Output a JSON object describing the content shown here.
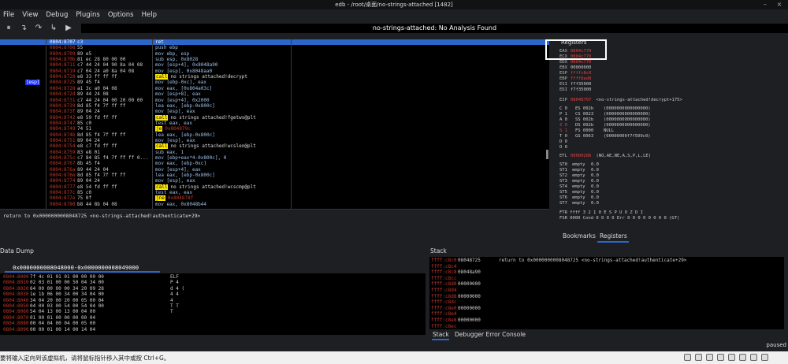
{
  "window": {
    "title": "edb - /root/桌面/no-strings-attached [1482]",
    "minimize": "–",
    "close": "×"
  },
  "menu": [
    "File",
    "View",
    "Debug",
    "Plugins",
    "Options",
    "Help"
  ],
  "toolbar": {
    "status": "no-strings-attached: No Analysis Found"
  },
  "disassembly": {
    "esp_tag": "[esp]",
    "rows": [
      {
        "addr": "0804:8707",
        "bytes": "c3",
        "ins": "ret"
      },
      {
        "addr": "0804:8708",
        "bytes": "55",
        "ins": "push ebp"
      },
      {
        "addr": "0804:8709",
        "bytes": "89 e5",
        "ins": "mov ebp, esp"
      },
      {
        "addr": "0804:870b",
        "bytes": "81 ec 28 80 00 00",
        "ins": "sub esp, 0x8028"
      },
      {
        "addr": "0804:8711",
        "bytes": "c7 44 24 04 90 8a 04 08",
        "ins": "mov [esp+4], 0x8048a90"
      },
      {
        "addr": "0804:8719",
        "bytes": "c7 04 24 a0 8a 04 08",
        "ins": "mov [esp], 0x8048aa0"
      },
      {
        "addr": "0804:8720",
        "bytes": "e8 33 ff ff ff",
        "ins": "call",
        "call": "no strings attached!decrypt"
      },
      {
        "addr": "0804:8725",
        "bytes": "89 45 f4",
        "ins": "mov [ebp-0xc], eax"
      },
      {
        "addr": "0804:8728",
        "bytes": "a1 3c a0 04 08",
        "ins": "mov eax, [0x804a03c]"
      },
      {
        "addr": "0804:872d",
        "bytes": "89 44 24 08",
        "ins": "mov [esp+8], eax"
      },
      {
        "addr": "0804:8731",
        "bytes": "c7 44 24 04 00 20 00 00",
        "ins": "mov [esp+4], 0x2000"
      },
      {
        "addr": "0804:8739",
        "bytes": "8d 85 f4 7f ff ff",
        "ins": "lea eax, [ebp-0x800c]"
      },
      {
        "addr": "0804:873f",
        "bytes": "89 04 24",
        "ins": "mov [esp], eax"
      },
      {
        "addr": "0804:8742",
        "bytes": "e8 59 fd ff ff",
        "ins": "call",
        "call": "no strings attached!fgetws@plt"
      },
      {
        "addr": "0804:8747",
        "bytes": "85 c0",
        "ins": "test eax, eax"
      },
      {
        "addr": "0804:8749",
        "bytes": "74 51",
        "ins": "je",
        "je": "0x804879c"
      },
      {
        "addr": "0804:874b",
        "bytes": "8d 85 f4 7f ff ff",
        "ins": "lea eax, [ebp-0x800c]"
      },
      {
        "addr": "0804:8751",
        "bytes": "89 04 24",
        "ins": "mov [esp], eax"
      },
      {
        "addr": "0804:8754",
        "bytes": "e8 c7 fd ff ff",
        "ins": "call",
        "call": "no strings attached!wcslen@plt"
      },
      {
        "addr": "0804:8759",
        "bytes": "83 e8 01",
        "ins": "sub eax, 1"
      },
      {
        "addr": "0804:875c",
        "bytes": "c7 84 85 f4 7f ff ff 0...",
        "ins": "mov [ebp+eax*4-0x800c], 0"
      },
      {
        "addr": "0804:8767",
        "bytes": "8b 45 f4",
        "ins": "mov eax, [ebp-0xc]"
      },
      {
        "addr": "0804:876a",
        "bytes": "89 44 24 04",
        "ins": "mov [esp+4], eax"
      },
      {
        "addr": "0804:876e",
        "bytes": "8d 85 f4 7f ff ff",
        "ins": "lea eax, [ebp-0x800c]"
      },
      {
        "addr": "0804:8774",
        "bytes": "89 04 24",
        "ins": "mov [esp], eax"
      },
      {
        "addr": "0804:8777",
        "bytes": "e8 54 fd ff ff",
        "ins": "call",
        "call": "no strings attached!wcscmp@plt"
      },
      {
        "addr": "0804:877c",
        "bytes": "85 c0",
        "ins": "test eax, eax"
      },
      {
        "addr": "0804:877e",
        "bytes": "75 0f",
        "ins": "jne",
        "je": "0x804878f"
      },
      {
        "addr": "0804:8780",
        "bytes": "b8 44 8b 04 08",
        "ins": "mov eax, 0x8048b44"
      }
    ],
    "return_text": "return to 0x0000000008048725 <no-strings-attached!authenticate+29>"
  },
  "registers": {
    "title": "Registers",
    "gp": [
      {
        "name": "EAX",
        "value": "0804c770",
        "red": true
      },
      {
        "name": "ECX",
        "value": "0804c770",
        "red": true
      },
      {
        "name": "EDX",
        "value": "0804c770",
        "red": true
      },
      {
        "name": "EBX",
        "value": "00000000",
        "red": false
      },
      {
        "name": "ESP",
        "value": "ffffc8c0",
        "red": true
      },
      {
        "name": "EBP",
        "value": "ffff8ad8",
        "red": true
      },
      {
        "name": "ESI",
        "value": "f7f35000",
        "red": false
      },
      {
        "name": "EDI",
        "value": "f7f35000",
        "red": false
      }
    ],
    "eip": {
      "name": "EIP",
      "value": "08048707",
      "desc": "<no-strings-attached!decrypt+175>"
    },
    "flags": [
      {
        "f": "C 0",
        "seg": "ES 002b",
        "seg_desc": "(0000000000000000)"
      },
      {
        "f": "P 1",
        "seg": "CS 0023",
        "seg_desc": "(0000000000000000)"
      },
      {
        "f": "A 0",
        "seg": "SS 002b",
        "seg_desc": "(0000000000000000)"
      },
      {
        "f": "Z 0",
        "seg": "DS 002b",
        "seg_desc": "(0000000000000000)"
      },
      {
        "f": "S 1",
        "seg": "FS 0000",
        "seg_desc": "NULL"
      },
      {
        "f": "T 0",
        "seg": "GS 0063",
        "seg_desc": "(00000000f7f509c0)"
      },
      {
        "f": "D 0",
        "seg": "",
        "seg_desc": ""
      },
      {
        "f": "O 0",
        "seg": "",
        "seg_desc": ""
      }
    ],
    "efl": {
      "name": "EFL",
      "value": "00000286",
      "desc": "(NO,AE,NE,A,S,P,L,LE)"
    },
    "fpu": [
      {
        "name": "ST0",
        "status": "empty",
        "val": "0.0"
      },
      {
        "name": "ST1",
        "status": "empty",
        "val": "0.0"
      },
      {
        "name": "ST2",
        "status": "empty",
        "val": "0.0"
      },
      {
        "name": "ST3",
        "status": "empty",
        "val": "0.0"
      },
      {
        "name": "ST4",
        "status": "empty",
        "val": "0.0"
      },
      {
        "name": "ST5",
        "status": "empty",
        "val": "0.0"
      },
      {
        "name": "ST6",
        "status": "empty",
        "val": "0.0"
      },
      {
        "name": "ST7",
        "status": "empty",
        "val": "0.0"
      }
    ],
    "ftr": "FTR  ffff        3 2 1 0      E S P U O Z D I",
    "fsr": "FSR  0000   Cond  0 0 0 0   Err  0 0 0 0 0 0 0 0  (GT)"
  },
  "reg_tabs": {
    "bookmarks": "Bookmarks",
    "registers": "Registers"
  },
  "dump": {
    "title": "Data Dump",
    "range": "0x0000000008048000-0x0000000008049000",
    "rows": [
      {
        "addr": "0804:8000",
        "hex": "7f  4c  01  01  01  00  00  00  00",
        "ascii": "ELF"
      },
      {
        "addr": "0804:8010",
        "hex": "02  03  01  00  00  50  04  34  00",
        "ascii": "      P   4"
      },
      {
        "addr": "0804:8020",
        "hex": "64  00  00  00  00  34  20  09  28",
        "ascii": "d        4   ("
      },
      {
        "addr": "0804:8030",
        "hex": "1e  1b  06  00  34  00  34  04  00",
        "ascii": "        4   4"
      },
      {
        "addr": "0804:8040",
        "hex": "34  04  20  00  20  00  05  00  04",
        "ascii": "4"
      },
      {
        "addr": "0804:8050",
        "hex": "04  00  03  00  54  00  54  04  00",
        "ascii": "      T   T"
      },
      {
        "addr": "0804:8060",
        "hex": "54  04  13  00  13  00  04  00",
        "ascii": "T"
      },
      {
        "addr": "0804:8070",
        "hex": "01  00  01  00  00  00  00  04",
        "ascii": ""
      },
      {
        "addr": "0804:8080",
        "hex": "00  04  04  00  04  00  05  00",
        "ascii": ""
      },
      {
        "addr": "0804:8090",
        "hex": "00  00  01  00  14  00  14  04",
        "ascii": ""
      }
    ]
  },
  "stack": {
    "title": "Stack",
    "rows": [
      {
        "addr": "ffff:c8c0",
        "val": "08048725",
        "comment": "return to 0x0000000008048725 <no-strings-attached!authenticate+29>"
      },
      {
        "addr": "ffff:c8c4",
        "val": "",
        "comment": ""
      },
      {
        "addr": "ffff:c8c8",
        "val": "08048a90",
        "comment": ""
      },
      {
        "addr": "ffff:c8cc",
        "val": "",
        "comment": ""
      },
      {
        "addr": "ffff:c8d0",
        "val": "00000000",
        "comment": ""
      },
      {
        "addr": "ffff:c8d4",
        "val": "",
        "comment": ""
      },
      {
        "addr": "ffff:c8d8",
        "val": "00000000",
        "comment": ""
      },
      {
        "addr": "ffff:c8dc",
        "val": "",
        "comment": ""
      },
      {
        "addr": "ffff:c8e0",
        "val": "00000000",
        "comment": ""
      },
      {
        "addr": "ffff:c8e4",
        "val": "",
        "comment": ""
      },
      {
        "addr": "ffff:c8e8",
        "val": "00000000",
        "comment": ""
      },
      {
        "addr": "ffff:c8ec",
        "val": "",
        "comment": ""
      }
    ]
  },
  "stack_tabs": {
    "stack": "Stack",
    "console": "Debugger Error Console"
  },
  "status": {
    "paused": "paused"
  },
  "bottom": {
    "text": "要将输入定向到该虚拟机，请将鼠标指针移入其中或按 Ctrl+G。"
  }
}
